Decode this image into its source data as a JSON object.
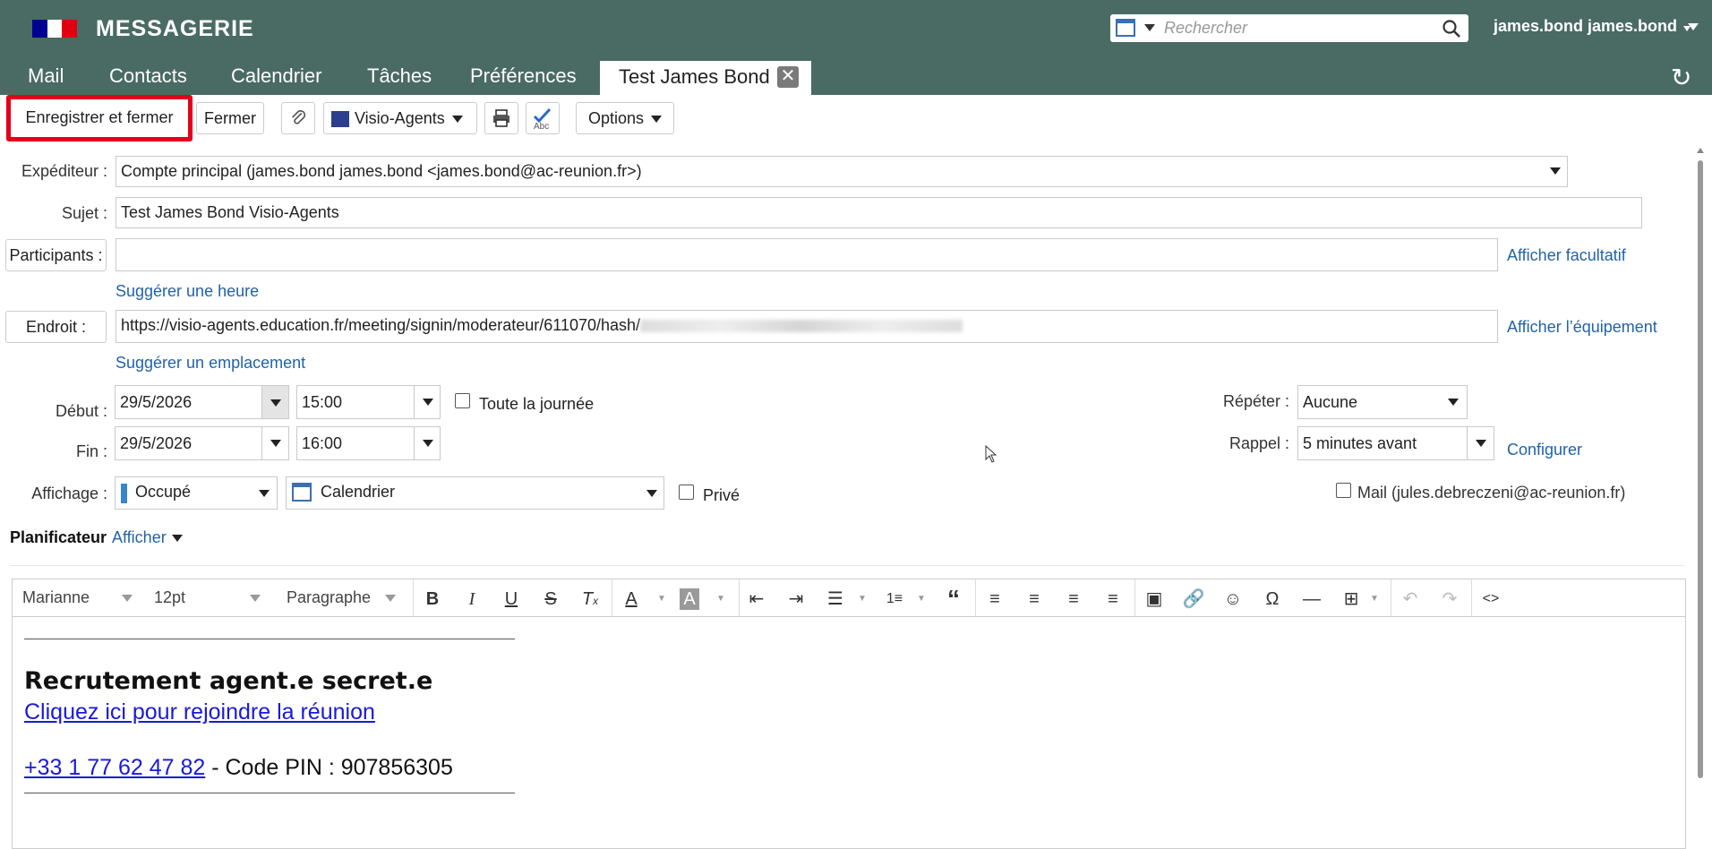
{
  "header": {
    "brand": "MESSAGERIE",
    "search_placeholder": "Rechercher",
    "user": "james.bond james.bond",
    "bg_color": "#4a6b63"
  },
  "nav": {
    "items": [
      "Mail",
      "Contacts",
      "Calendrier",
      "Tâches",
      "Préférences"
    ],
    "active_tab": "Test James Bond"
  },
  "toolbar": {
    "save_close": "Enregistrer et fermer",
    "close": "Fermer",
    "visio": "Visio-Agents",
    "options": "Options"
  },
  "form": {
    "sender_label": "Expéditeur :",
    "sender_value": "Compte principal (james.bond james.bond <james.bond@ac-reunion.fr>)",
    "subject_label": "Sujet :",
    "subject_value": "Test James Bond Visio-Agents",
    "participants_label": "Participants :",
    "participants_value": "",
    "show_optional": "Afficher facultatif",
    "suggest_time": "Suggérer une heure",
    "location_label": "Endroit :",
    "location_value": "https://visio-agents.education.fr/meeting/signin/moderateur/611070/hash/",
    "show_equipment": "Afficher l’équipement",
    "suggest_location": "Suggérer un emplacement",
    "start_label": "Début :",
    "start_date": "29/5/2026",
    "start_time": "15:00",
    "all_day": "Toute la journée",
    "end_label": "Fin :",
    "end_date": "29/5/2026",
    "end_time": "16:00",
    "repeat_label": "Répéter :",
    "repeat_value": "Aucune",
    "reminder_label": "Rappel :",
    "reminder_value": "5 minutes avant",
    "configure": "Configurer",
    "display_label": "Affichage :",
    "display_value": "Occupé",
    "calendar_value": "Calendrier",
    "private": "Privé",
    "mail_notify": "Mail (jules.debreczeni@ac-reunion.fr)",
    "planner_label": "Planificateur",
    "planner_show": "Afficher"
  },
  "editor": {
    "font": "Marianne",
    "size": "12pt",
    "block": "Paragraphe",
    "heading": "Recrutement agent.e secret.e",
    "join_link": "Cliquez ici pour rejoindre la réunion",
    "phone": "+33 1 77 62 47 82",
    "pin_text": " - Code PIN : 907856305"
  }
}
